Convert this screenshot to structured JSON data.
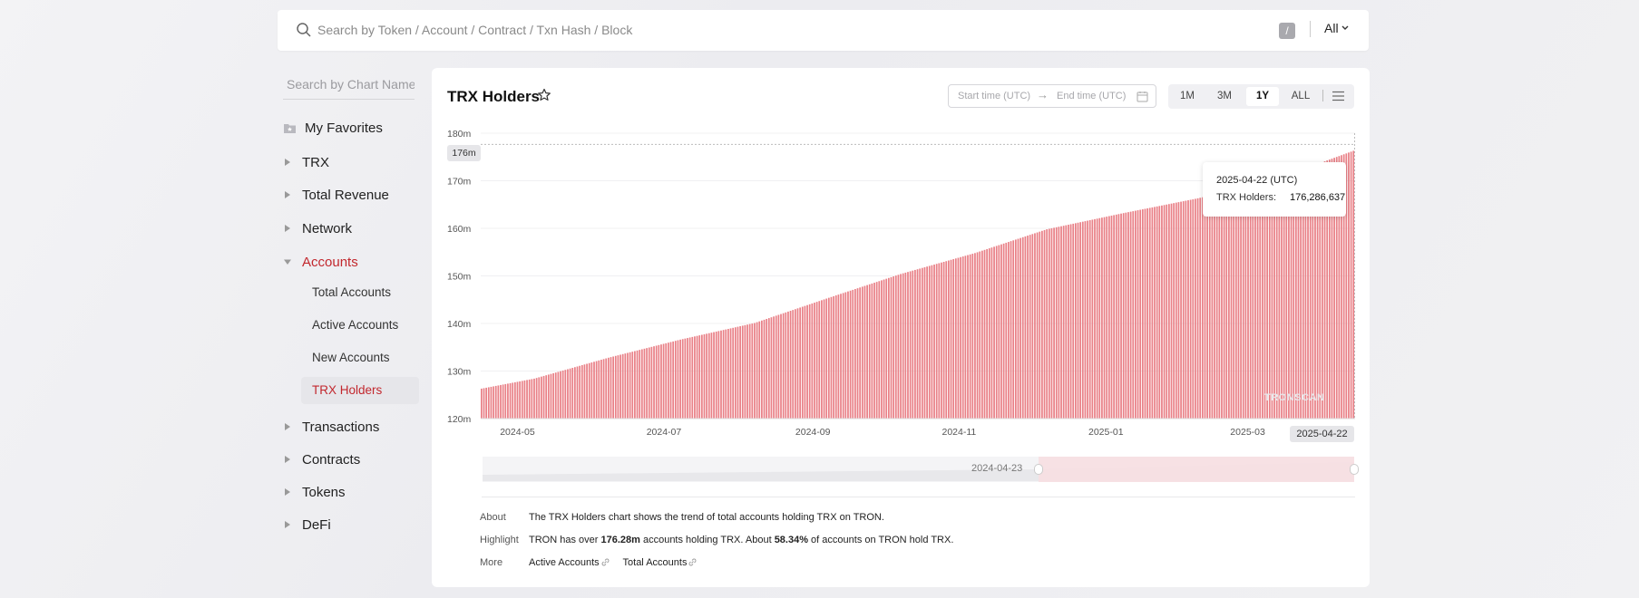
{
  "search": {
    "placeholder": "Search by Token / Account / Contract / Txn Hash / Block",
    "shortcut": "/",
    "filter": "All"
  },
  "sidebar": {
    "search_placeholder": "Search by Chart Name",
    "favorites": "My Favorites",
    "groups": [
      "TRX",
      "Total Revenue",
      "Network",
      "Accounts",
      "Transactions",
      "Contracts",
      "Tokens",
      "DeFi"
    ],
    "accounts_items": [
      "Total Accounts",
      "Active Accounts",
      "New Accounts",
      "TRX Holders"
    ]
  },
  "panel": {
    "title": "TRX Holders",
    "start_placeholder": "Start time (UTC)",
    "end_placeholder": "End time (UTC)",
    "ranges": [
      "1M",
      "3M",
      "1Y",
      "ALL"
    ],
    "selected_range": "1Y"
  },
  "tooltip": {
    "date": "2025-04-22 (UTC)",
    "label": "TRX Holders:",
    "value": "176,286,637"
  },
  "markers": {
    "y": "176m",
    "x": "2025-04-22"
  },
  "watermark": "TRONSCAN",
  "slider": {
    "start_label": "2024-04-23"
  },
  "info": {
    "about_label": "About",
    "about_text": "The TRX Holders chart shows the trend of total accounts holding TRX on TRON.",
    "highlight_label": "Highlight",
    "highlight_pre": "TRON has over ",
    "highlight_num1": "176.28m",
    "highlight_mid": " accounts holding TRX.  About ",
    "highlight_num2": "58.34%",
    "highlight_post": " of accounts on TRON hold TRX.",
    "more_label": "More",
    "more_links": [
      "Active Accounts",
      "Total Accounts"
    ]
  },
  "colors": {
    "accent": "#c2272d",
    "bar": "#e98087"
  },
  "chart_data": {
    "type": "bar",
    "x_start": "2024-04-23",
    "x_end": "2025-04-22",
    "xticks": [
      "2024-05",
      "2024-07",
      "2024-09",
      "2024-11",
      "2025-01",
      "2025-03"
    ],
    "yticks": [
      "120m",
      "130m",
      "140m",
      "150m",
      "160m",
      "170m",
      "180m"
    ],
    "ylim": [
      120,
      180
    ],
    "y_unit": "m",
    "series": [
      {
        "anchors_x": [
          "2024-04-23",
          "2024-05-15",
          "2024-06-15",
          "2024-07-15",
          "2024-08-15",
          "2024-09-15",
          "2024-10-15",
          "2024-11-15",
          "2024-12-15",
          "2025-01-15",
          "2025-02-15",
          "2025-03-15",
          "2025-04-22"
        ],
        "anchors_y": [
          126.3,
          128.4,
          132.8,
          136.6,
          140.1,
          145.4,
          150.4,
          154.8,
          159.8,
          163.1,
          166.2,
          169.3,
          176.3
        ]
      }
    ],
    "grid": true
  }
}
